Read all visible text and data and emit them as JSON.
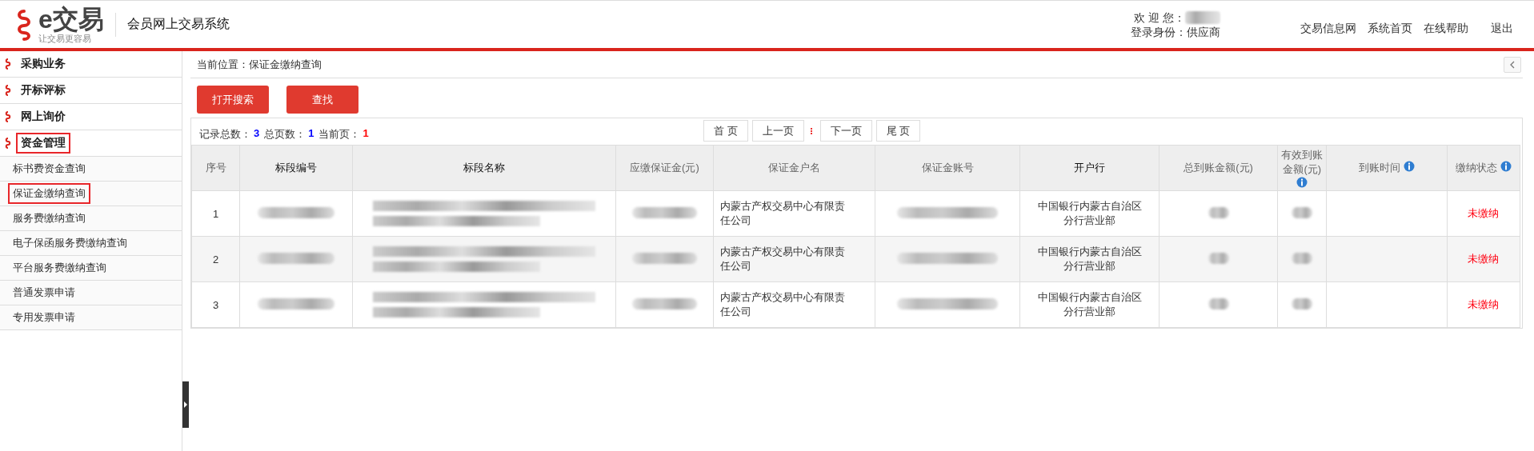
{
  "header": {
    "logo": {
      "name": "e交易",
      "tagline": "让交易更容易"
    },
    "system_title": "会员网上交易系统",
    "welcome_label": "欢 迎 您：",
    "identity": "登录身份：供应商",
    "nav_links": [
      "交易信息网",
      "系统首页",
      "在线帮助",
      "退出"
    ]
  },
  "sidebar": {
    "sections": [
      {
        "label": "采购业务",
        "selected": false
      },
      {
        "label": "开标评标",
        "selected": false
      },
      {
        "label": "网上询价",
        "selected": false
      },
      {
        "label": "资金管理",
        "selected": true,
        "children": [
          {
            "label": "标书费资金查询",
            "selected": false
          },
          {
            "label": "保证金缴纳查询",
            "selected": true
          },
          {
            "label": "服务费缴纳查询",
            "selected": false
          },
          {
            "label": "电子保函服务费缴纳查询",
            "selected": false
          },
          {
            "label": "平台服务费缴纳查询",
            "selected": false
          },
          {
            "label": "普通发票申请",
            "selected": false
          },
          {
            "label": "专用发票申请",
            "selected": false
          }
        ]
      }
    ]
  },
  "breadcrumb": "当前位置：保证金缴纳查询",
  "buttons": [
    "打开搜索",
    "查找"
  ],
  "summary": [
    {
      "label": "记录总数：",
      "value": "3",
      "color": "#0000ff"
    },
    {
      "label": "总页数：",
      "value": "1",
      "color": "#0000ff"
    },
    {
      "label": "当前页：",
      "value": "1",
      "color": "#ff0000"
    }
  ],
  "pagination": [
    "首 页",
    "上一页",
    "下一页",
    "尾 页"
  ],
  "table": {
    "columns": [
      {
        "label": "序号",
        "kind": "index",
        "strong": false,
        "info": false
      },
      {
        "label": "标段编号",
        "kind": "redacted",
        "strong": true,
        "info": false
      },
      {
        "label": "标段名称",
        "kind": "redacted-long",
        "strong": true,
        "info": false
      },
      {
        "label": "应缴保证金(元)",
        "kind": "redacted",
        "strong": false,
        "info": false
      },
      {
        "label": "保证金户名",
        "kind": "holder",
        "strong": false,
        "info": false
      },
      {
        "label": "保证金账号",
        "kind": "redacted",
        "strong": false,
        "info": false
      },
      {
        "label": "开户行",
        "kind": "bank",
        "strong": true,
        "info": false
      },
      {
        "label": "总到账金额(元)",
        "kind": "redacted-short",
        "strong": false,
        "info": false
      },
      {
        "label": "有效到账金额(元)",
        "kind": "redacted-short",
        "strong": false,
        "info": true
      },
      {
        "label": "到账时间",
        "kind": "blank",
        "strong": false,
        "info": true
      },
      {
        "label": "缴纳状态",
        "kind": "status",
        "strong": false,
        "info": true
      }
    ],
    "rows": [
      {
        "number": "1",
        "holder": "内蒙古产权交易中心有限责任公司",
        "bank": "中国银行内蒙古自治区分行营业部",
        "status": "未缴纳"
      },
      {
        "number": "2",
        "holder": "内蒙古产权交易中心有限责任公司",
        "bank": "中国银行内蒙古自治区分行营业部",
        "status": "未缴纳"
      },
      {
        "number": "3",
        "holder": "内蒙古产权交易中心有限责任公司",
        "bank": "中国银行内蒙古自治区分行营业部",
        "status": "未缴纳"
      }
    ]
  }
}
